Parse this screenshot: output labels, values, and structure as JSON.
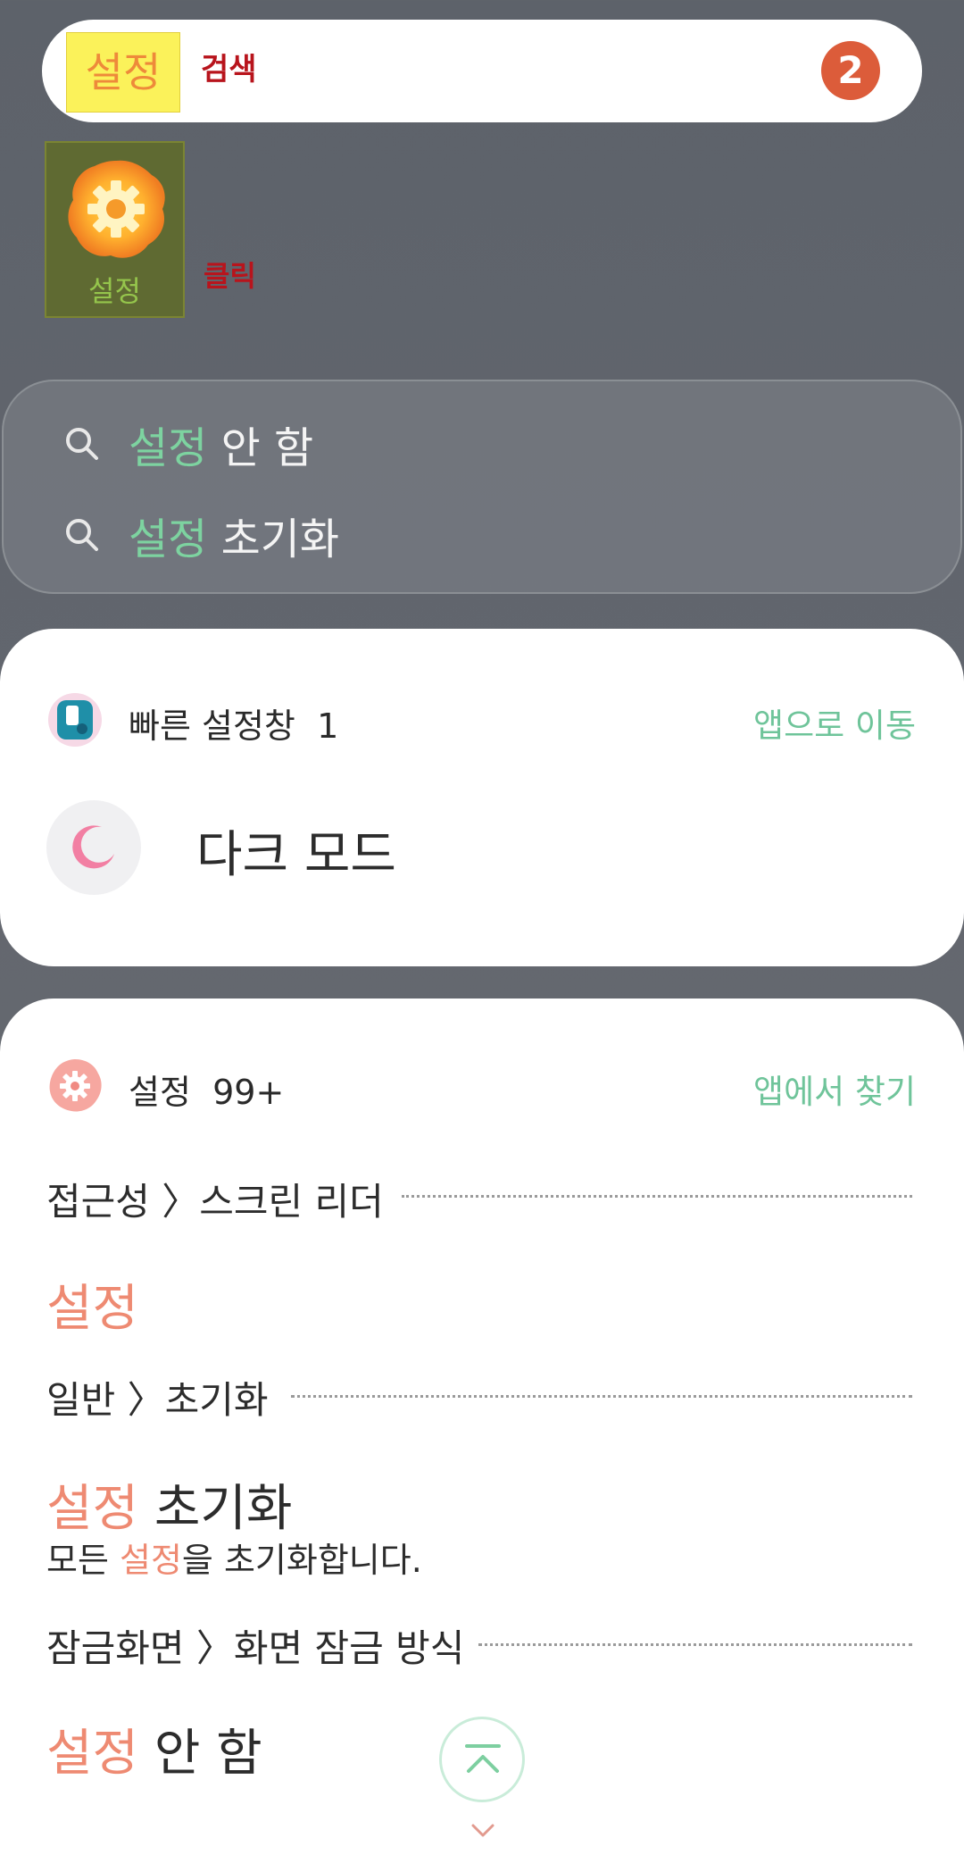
{
  "search": {
    "query": "설정",
    "annotation": "검색",
    "step_badge": "2",
    "badge_color": "#dc5c3a"
  },
  "app_result": {
    "label": "설정",
    "icon": "settings-gear-icon",
    "annotation": "클릭"
  },
  "suggestions": [
    {
      "highlight": "설정",
      "rest": " 안 함",
      "icon": "search-icon"
    },
    {
      "highlight": "설정",
      "rest": " 초기화",
      "icon": "search-icon"
    }
  ],
  "quick_panel": {
    "title": "빠른 설정창",
    "count": "1",
    "link": "앱으로 이동",
    "icon": "quick-panel-icon",
    "item_label": "다크 모드",
    "item_icon": "moon-icon"
  },
  "settings_card": {
    "title": "설정",
    "count": "99+",
    "link": "앱에서 찾기",
    "icon": "settings-gear-icon",
    "results": [
      {
        "path": "접근성 〉스크린 리더",
        "title_highlight": "설정",
        "title_rest": "",
        "desc": ""
      },
      {
        "path": "일반 〉초기화",
        "title_highlight": "설정",
        "title_rest": " 초기화",
        "desc_pre": "모든 ",
        "desc_hl": "설정",
        "desc_post": "을 초기화합니다."
      },
      {
        "path": "잠금화면 〉화면 잠금 방식",
        "title_highlight": "설정",
        "title_rest": " 안 함",
        "desc": ""
      }
    ]
  },
  "colors": {
    "accent_green": "#6fc49a",
    "highlight_salmon": "#ee8a72",
    "search_highlight_yellow": "#fbf25a"
  }
}
